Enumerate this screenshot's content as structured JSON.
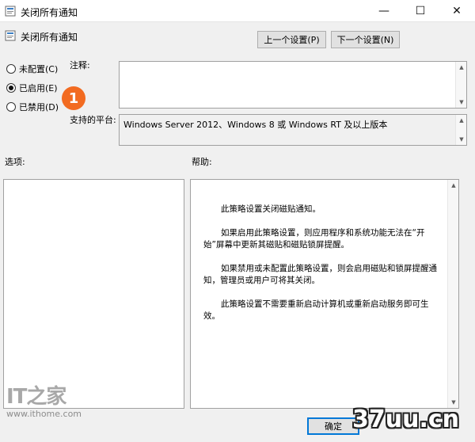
{
  "window": {
    "title": "关闭所有通知",
    "minimize": "—",
    "maximize": "☐",
    "close": "✕"
  },
  "header": {
    "title": "关闭所有通知",
    "prev_button": "上一个设置(P)",
    "next_button": "下一个设置(N)"
  },
  "state_options": [
    {
      "label": "未配置(C)",
      "selected": false
    },
    {
      "label": "已启用(E)",
      "selected": true
    },
    {
      "label": "已禁用(D)",
      "selected": false
    }
  ],
  "comment_label": "注释:",
  "comment_value": "",
  "platform_label": "支持的平台:",
  "platform_value": "Windows Server 2012、Windows 8 或 Windows RT 及以上版本",
  "options_label": "选项:",
  "help_label": "帮助:",
  "help_paragraphs": [
    "此策略设置关闭磁贴通知。",
    "如果启用此策略设置，则应用程序和系统功能无法在“开始”屏幕中更新其磁贴和磁贴锁屏提醒。",
    "如果禁用或未配置此策略设置，则会启用磁贴和锁屏提醒通知，管理员或用户可将其关闭。",
    "此策略设置不需要重新启动计算机或重新启动服务即可生效。"
  ],
  "footer": {
    "ok_button": "确定"
  },
  "annotation_badge": "1",
  "watermarks": {
    "logo": "IT之家",
    "url": "www.ithome.com",
    "site": "37uu.cn"
  },
  "colors": {
    "badge": "#f26b21",
    "window_bg": "#f0f0f0"
  }
}
